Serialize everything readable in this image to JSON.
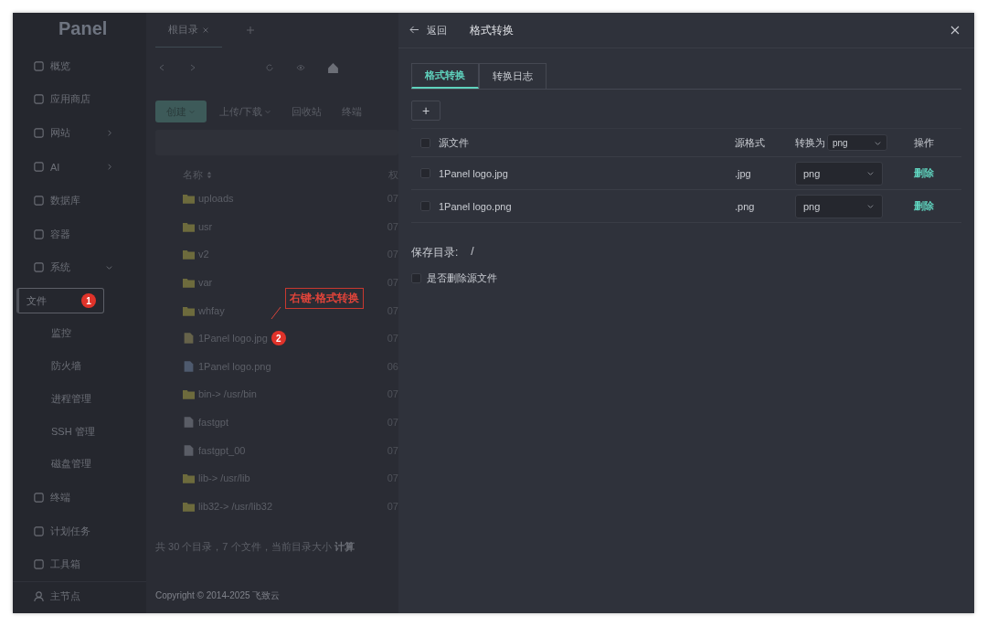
{
  "sidebar": {
    "logo": "Panel",
    "items": [
      {
        "label": "概览",
        "kind": "link"
      },
      {
        "label": "应用商店",
        "kind": "link"
      },
      {
        "label": "网站",
        "kind": "group",
        "expanded": false
      },
      {
        "label": "AI",
        "kind": "group",
        "expanded": false
      },
      {
        "label": "数据库",
        "kind": "link"
      },
      {
        "label": "容器",
        "kind": "link"
      },
      {
        "label": "系统",
        "kind": "group",
        "expanded": true,
        "children": [
          {
            "label": "文件",
            "selected": true,
            "badge": "1"
          },
          {
            "label": "监控",
            "selected": false
          },
          {
            "label": "防火墙",
            "selected": false
          },
          {
            "label": "进程管理",
            "selected": false
          },
          {
            "label": "SSH 管理",
            "selected": false
          },
          {
            "label": "磁盘管理",
            "selected": false
          }
        ]
      },
      {
        "label": "终端",
        "kind": "link"
      },
      {
        "label": "计划任务",
        "kind": "link"
      },
      {
        "label": "工具箱",
        "kind": "link"
      }
    ],
    "node": "主节点"
  },
  "file_tabs": [
    {
      "label": "根目录",
      "selected": true
    }
  ],
  "toolbar": {
    "buttons": [
      {
        "label": "创建",
        "kind": "primary"
      },
      {
        "label": "上传/下载",
        "kind": "dropdown"
      },
      {
        "label": "回收站",
        "kind": "plain"
      },
      {
        "label": "终端",
        "kind": "plain"
      }
    ]
  },
  "file_table": {
    "columns": [
      "名称",
      "权"
    ],
    "rows": [
      {
        "name": "uploads",
        "kind": "folder",
        "perm": "07"
      },
      {
        "name": "usr",
        "kind": "folder",
        "perm": "07"
      },
      {
        "name": "v2",
        "kind": "folder",
        "perm": "07"
      },
      {
        "name": "var",
        "kind": "folder",
        "perm": "07"
      },
      {
        "name": "whfay",
        "kind": "folder",
        "perm": "07"
      },
      {
        "name": "1Panel logo.jpg",
        "kind": "image",
        "perm": "07",
        "badge": "2"
      },
      {
        "name": "1Panel logo.png",
        "kind": "png",
        "perm": "06"
      },
      {
        "name": "bin-> /usr/bin",
        "kind": "folder",
        "perm": "07"
      },
      {
        "name": "fastgpt",
        "kind": "file",
        "perm": "07"
      },
      {
        "name": "fastgpt_00",
        "kind": "file",
        "perm": "07"
      },
      {
        "name": "lib-> /usr/lib",
        "kind": "folder",
        "perm": "07"
      },
      {
        "name": "lib32-> /usr/lib32",
        "kind": "folder",
        "perm": "07"
      }
    ]
  },
  "summary": "共 30 个目录，7 个文件，当前目录大小",
  "calc_link": "计算",
  "copyright": "Copyright © 2014-2025 飞致云",
  "annotation": "右键-格式转换",
  "drawer": {
    "back": "返回",
    "title": "格式转换",
    "tabs": [
      {
        "label": "格式转换",
        "selected": true
      },
      {
        "label": "转换日志",
        "selected": false
      }
    ],
    "add_button": "+",
    "columns": [
      "源文件",
      "源格式",
      "转换为",
      "操作"
    ],
    "header_checked": false,
    "bulk_target": "png",
    "rows": [
      {
        "checked": false,
        "file": "1Panel logo.jpg",
        "format": ".jpg",
        "target": "png",
        "action": "删除"
      },
      {
        "checked": false,
        "file": "1Panel logo.png",
        "format": ".png",
        "target": "png",
        "action": "删除"
      }
    ],
    "save_label": "保存目录:",
    "save_value": "/",
    "delete_source": {
      "label": "是否删除源文件",
      "checked": false
    }
  }
}
